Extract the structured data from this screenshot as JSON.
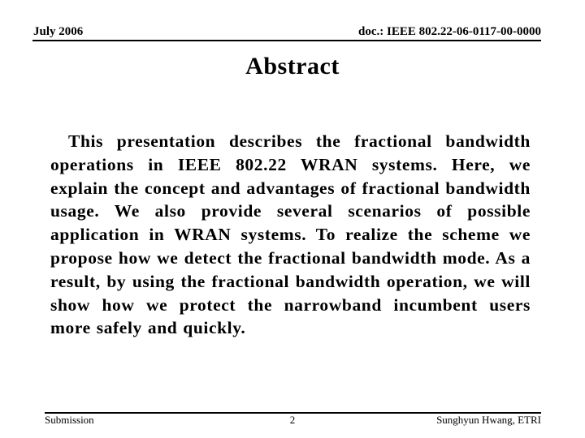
{
  "header": {
    "date": "July 2006",
    "doc_id": "doc.: IEEE 802.22-06-0117-00-0000"
  },
  "slide": {
    "title": "Abstract",
    "body": "This presentation describes the fractional bandwidth operations in IEEE 802.22 WRAN systems. Here, we explain the concept and advantages of fractional bandwidth usage. We also provide several scenarios of possible application in WRAN systems. To realize the scheme we propose how we detect the fractional bandwidth mode. As a result, by using the fractional bandwidth operation, we will show how we protect the narrowband incumbent users more safely and quickly."
  },
  "footer": {
    "left": "Submission",
    "page_number": "2",
    "author": "Sunghyun Hwang, ETRI"
  }
}
